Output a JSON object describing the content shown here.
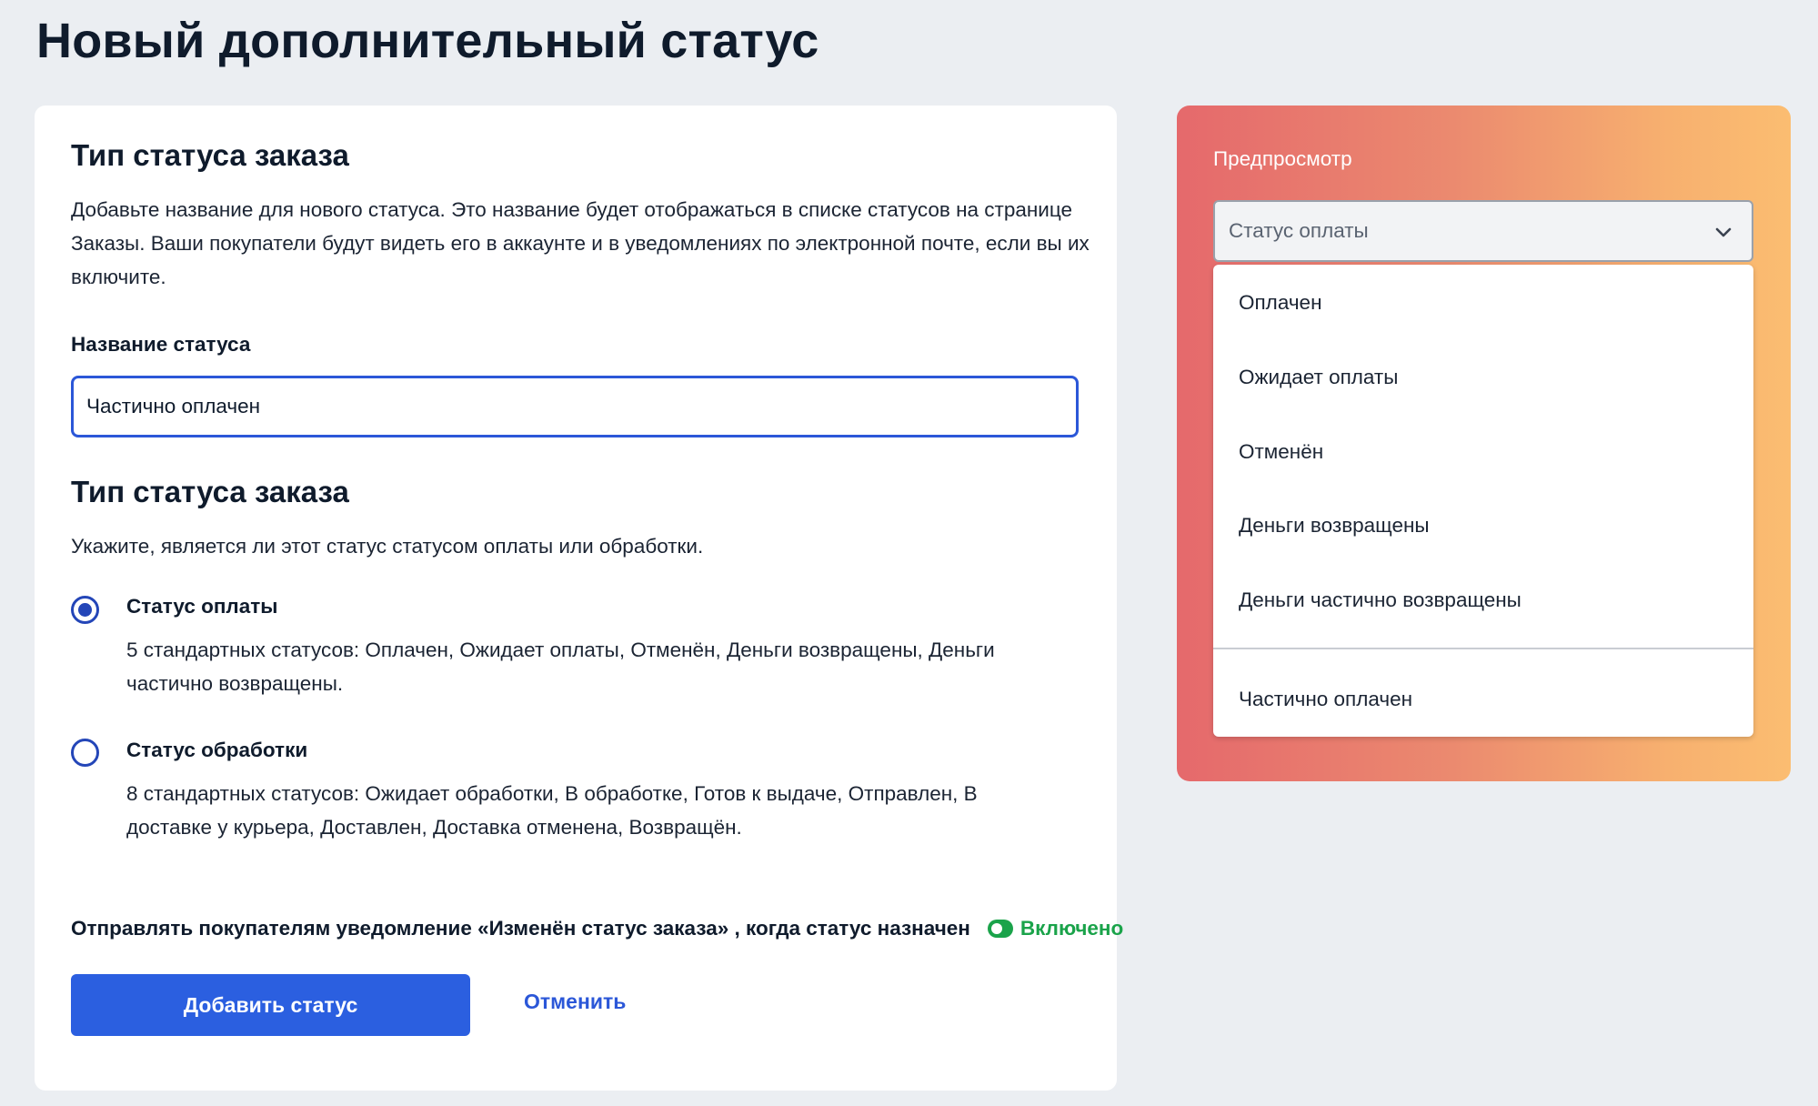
{
  "page": {
    "title": "Новый дополнительный статус"
  },
  "form": {
    "section1": {
      "title": "Тип статуса заказа",
      "description": "Добавьте название для нового статуса. Это название будет отображаться в списке статусов на странице Заказы. Ваши покупатели будут видеть его в аккаунте и в уведомлениях по электронной почте, если вы их включите."
    },
    "name_field": {
      "label": "Название статуса",
      "value": "Частично оплачен"
    },
    "section2": {
      "title": "Тип статуса заказа",
      "description": "Укажите, является ли этот статус статусом оплаты или обработки."
    },
    "options": [
      {
        "title": "Статус оплаты",
        "description": "5 стандартных статусов: Оплачен, Ожидает оплаты, Отменён, Деньги возвращены, Деньги частично возвращены.",
        "selected": true
      },
      {
        "title": "Статус обработки",
        "description": "8 стандартных статусов: Ожидает обработки, В обработке, Готов к выдаче, Отправлен, В доставке у курьера, Доставлен, Доставка отменена, Возвращён.",
        "selected": false
      }
    ],
    "notification": {
      "text": "Отправлять покупателям уведомление «Изменён статус заказа» , когда статус назначен",
      "toggle_label": "Включено",
      "enabled": true
    },
    "submit_label": "Добавить статус",
    "cancel_label": "Отменить"
  },
  "preview": {
    "label": "Предпросмотр",
    "select_value": "Статус оплаты",
    "options": [
      "Оплачен",
      "Ожидает оплаты",
      "Отменён",
      "Деньги возвращены",
      "Деньги частично возвращены"
    ],
    "custom_option": "Частично оплачен"
  },
  "colors": {
    "accent": "#2b5fe0",
    "success": "#1aa34a",
    "background": "#ebeef2",
    "preview_gradient_start": "#e5696c",
    "preview_gradient_end": "#fbbd71"
  }
}
